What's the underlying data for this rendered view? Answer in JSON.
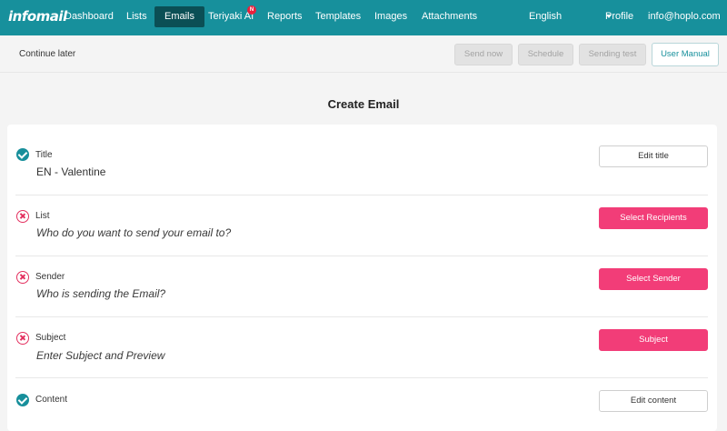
{
  "nav": {
    "logo": "infomail",
    "items": [
      "Dashboard",
      "Lists",
      "Emails",
      "Teriyaki AI",
      "Reports",
      "Templates",
      "Images",
      "Attachments"
    ],
    "active": "Emails",
    "ai_badge": "N",
    "language": "English",
    "profile": "Profile",
    "email": "info@hoplo.com"
  },
  "toolbar": {
    "continue_later": "Continue later",
    "send_now": "Send now",
    "schedule": "Schedule",
    "sending_test": "Sending test",
    "user_manual": "User Manual"
  },
  "page_title": "Create Email",
  "steps": [
    {
      "label": "Title",
      "value": "EN - Valentine",
      "status": "ok",
      "button": "Edit title"
    },
    {
      "label": "List",
      "value": "Who do you want to send your email to?",
      "status": "error",
      "button": "Select Recipients"
    },
    {
      "label": "Sender",
      "value": "Who is sending the Email?",
      "status": "error",
      "button": "Select Sender"
    },
    {
      "label": "Subject",
      "value": "Enter Subject and Preview",
      "status": "error",
      "button": "Subject"
    },
    {
      "label": "Content",
      "value": "",
      "status": "ok",
      "button": "Edit content"
    }
  ],
  "colors": {
    "nav_bg": "#17909c",
    "active_tab_bg": "#0b4f55",
    "primary_action": "#f23d78",
    "ok": "#178f9b",
    "error": "#e3305f"
  }
}
